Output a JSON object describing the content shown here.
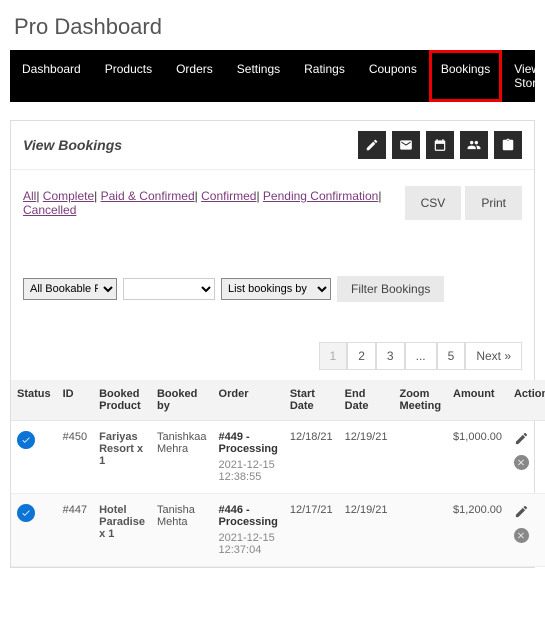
{
  "page_title": "Pro Dashboard",
  "nav": [
    "Dashboard",
    "Products",
    "Orders",
    "Settings",
    "Ratings",
    "Coupons",
    "Bookings",
    "View Store"
  ],
  "nav_active": "Bookings",
  "panel_title": "View Bookings",
  "status_filters": [
    "All",
    "Complete",
    "Paid & Confirmed",
    "Confirmed",
    "Pending Confirmation",
    "Cancelled"
  ],
  "export": {
    "csv": "CSV",
    "print": "Print"
  },
  "controls": {
    "product_select": "All Bookable Products",
    "second_select": "",
    "list_by": "List bookings by",
    "filter_btn": "Filter Bookings"
  },
  "pagination": [
    "1",
    "2",
    "3",
    "...",
    "5",
    "Next »"
  ],
  "pagination_current": "1",
  "columns": [
    "Status",
    "ID",
    "Booked Product",
    "Booked by",
    "Order",
    "Start Date",
    "End Date",
    "Zoom Meeting",
    "Amount",
    "Actions"
  ],
  "rows": [
    {
      "id": "#450",
      "product": "Fariyas Resort x 1",
      "by": "Tanishkaa Mehra",
      "order_num": "#449 - Processing",
      "order_date": "2021-12-15 12:38:55",
      "start": "12/18/21",
      "end": "12/19/21",
      "zoom": "",
      "amount": "$1,000.00"
    },
    {
      "id": "#447",
      "product": "Hotel Paradise x 1",
      "by": "Tanisha Mehta",
      "order_num": "#446 - Processing",
      "order_date": "2021-12-15 12:37:04",
      "start": "12/17/21",
      "end": "12/19/21",
      "zoom": "",
      "amount": "$1,200.00"
    }
  ]
}
